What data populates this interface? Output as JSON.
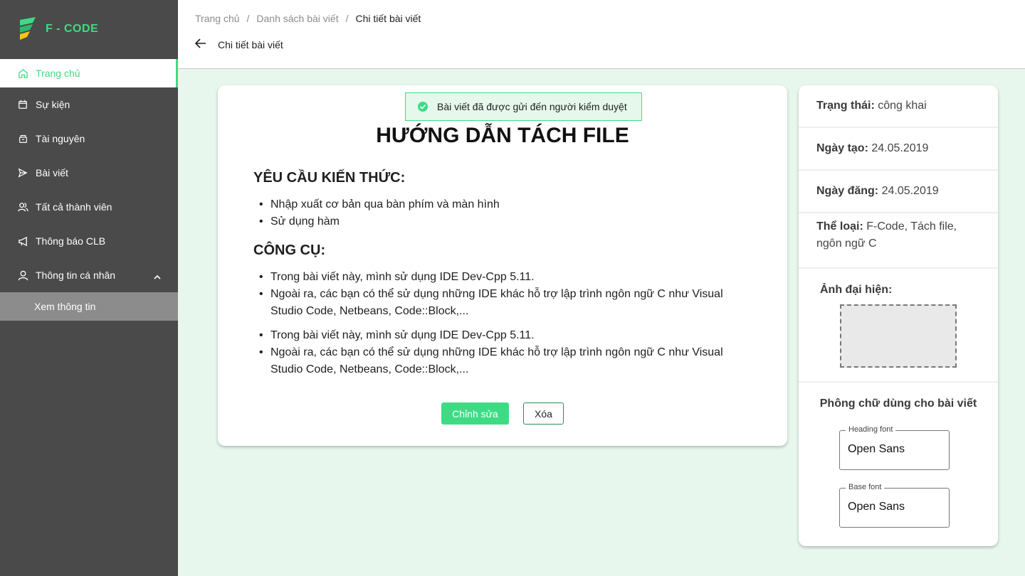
{
  "brand": {
    "name": "F - CODE"
  },
  "sidebar": {
    "items": [
      {
        "label": "Trang chủ",
        "icon": "home-icon"
      },
      {
        "label": "Sự kiện",
        "icon": "calendar-icon"
      },
      {
        "label": "Tài nguyên",
        "icon": "archive-icon"
      },
      {
        "label": "Bài viết",
        "icon": "send-icon"
      },
      {
        "label": "Tất cả thành viên",
        "icon": "users-icon"
      },
      {
        "label": "Thông báo CLB",
        "icon": "megaphone-icon"
      },
      {
        "label": "Thông tin cá nhân",
        "icon": "user-icon"
      }
    ],
    "sub_item": "Xem thông tin"
  },
  "header": {
    "breadcrumb": [
      "Trang chủ",
      "/",
      "Danh sách bài viết",
      "/",
      "Chi tiết bài viết"
    ],
    "title": "Chi tiết bài viết"
  },
  "toast": {
    "message": "Bài viết đã được gửi đến người kiểm duyệt"
  },
  "post": {
    "title": "HƯỚNG DẪN TÁCH FILE",
    "section1": {
      "heading": "YÊU CẦU KIẾN THỨC:",
      "items": [
        "Nhập xuất cơ bản qua bàn phím và màn hình",
        "Sử dụng hàm"
      ]
    },
    "section2": {
      "heading": "CÔNG CỤ:",
      "items": [
        "Trong bài viết này, mình sử dụng IDE Dev-Cpp 5.11.",
        "Ngoài ra, các bạn có thể sử dụng những IDE khác hỗ trợ lập trình ngôn ngữ C như Visual Studio Code, Netbeans, Code::Block,...",
        "Trong bài viết này, mình sử dụng IDE Dev-Cpp 5.11.",
        "Ngoài ra, các bạn có thể sử dụng những IDE khác hỗ trợ lập trình ngôn ngữ C như Visual Studio Code, Netbeans, Code::Block,..."
      ]
    },
    "edit_label": "Chỉnh sửa",
    "delete_label": "Xóa"
  },
  "info": {
    "status_key": "Trạng thái:",
    "status_val": "công khai",
    "created_key": "Ngày tạo:",
    "created_val": "24.05.2019",
    "published_key": "Ngày đăng:",
    "published_val": "24.05.2019",
    "category_key": "Thể loại:",
    "category_val": "F-Code, Tách file, ngôn ngữ C",
    "thumbnail_label": "Ảnh đại hiện:",
    "font_title": "Phông chữ dùng cho bài viết",
    "heading_font_label": "Heading font",
    "heading_font_value": "Open Sans",
    "base_font_label": "Base font",
    "base_font_value": "Open Sans"
  },
  "colors": {
    "accent": "#3ddc84",
    "sidebar": "#4a4a4a",
    "background": "#e8f7ee"
  }
}
